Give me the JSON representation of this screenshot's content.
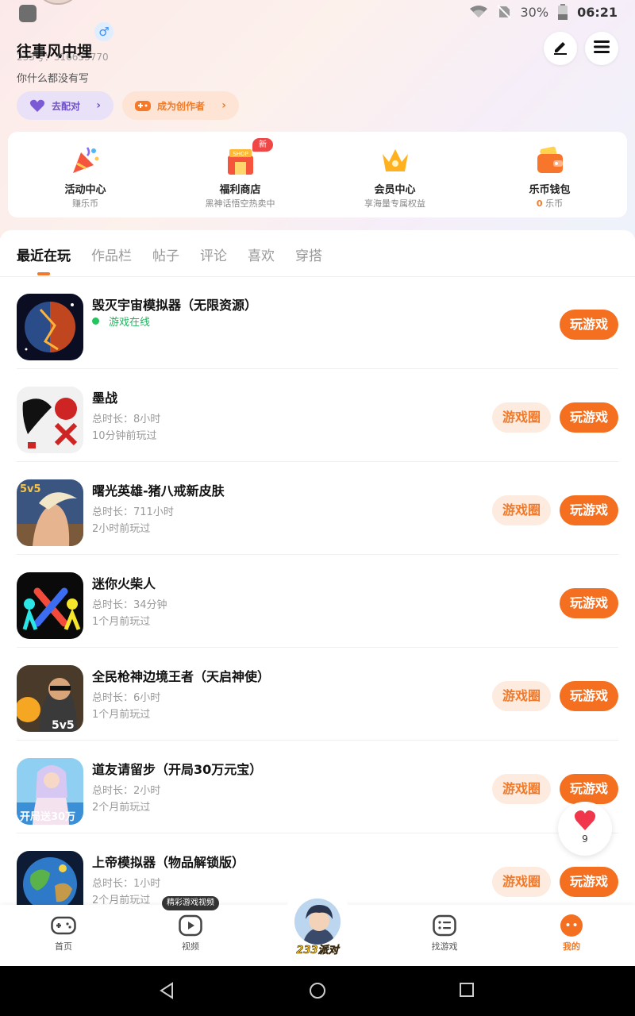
{
  "status_bar": {
    "battery": "30%",
    "time": "06:21"
  },
  "profile": {
    "username": "往事风中埋",
    "uid": "233号：316653770",
    "bio": "你什么都没有写",
    "match_label": "去配对",
    "creator_label": "成为创作者"
  },
  "features": [
    {
      "title": "活动中心",
      "sub": "赚乐币",
      "icon": "party-popper-icon"
    },
    {
      "title": "福利商店",
      "sub": "黑神话悟空热卖中",
      "icon": "shop-icon",
      "badge": "新"
    },
    {
      "title": "会员中心",
      "sub": "享海量专属权益",
      "icon": "crown-icon"
    },
    {
      "title": "乐币钱包",
      "sub_num": "0",
      "sub_unit": "乐币",
      "icon": "wallet-icon"
    }
  ],
  "tabs": [
    "最近在玩",
    "作品栏",
    "帖子",
    "评论",
    "喜欢",
    "穿搭"
  ],
  "games": [
    {
      "name": "毁灭宇宙模拟器（无限资源）",
      "status": "游戏在线",
      "play": "玩游戏"
    },
    {
      "name": "墨战",
      "duration": "总时长：8小时",
      "last": "10分钟前玩过",
      "circle": "游戏圈",
      "play": "玩游戏"
    },
    {
      "name": "曙光英雄-猪八戒新皮肤",
      "duration": "总时长：711小时",
      "last": "2小时前玩过",
      "circle": "游戏圈",
      "play": "玩游戏"
    },
    {
      "name": "迷你火柴人",
      "duration": "总时长：34分钟",
      "last": "1个月前玩过",
      "play": "玩游戏"
    },
    {
      "name": "全民枪神边境王者（天启神使）",
      "duration": "总时长：6小时",
      "last": "1个月前玩过",
      "circle": "游戏圈",
      "play": "玩游戏"
    },
    {
      "name": "道友请留步（开局30万元宝）",
      "duration": "总时长：2小时",
      "last": "2个月前玩过",
      "circle": "游戏圈",
      "play": "玩游戏"
    },
    {
      "name": "上帝模拟器（物品解锁版）",
      "duration": "总时长：1小时",
      "last": "2个月前玩过",
      "circle": "游戏圈",
      "play": "玩游戏"
    }
  ],
  "float_like": {
    "count": "9"
  },
  "bottom_nav": {
    "home": "首页",
    "video": "视频",
    "video_tip": "精彩游戏视频",
    "center": "233派对",
    "find": "找游戏",
    "mine": "我的"
  },
  "colors": {
    "accent": "#f47020",
    "online": "#22b35e",
    "badge": "#f04646"
  }
}
